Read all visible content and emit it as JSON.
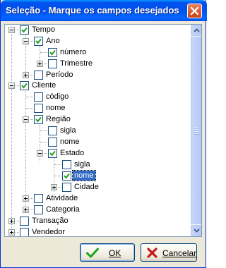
{
  "window": {
    "title": "Seleção - Marque os campos desejados"
  },
  "tree": {
    "items": [
      {
        "label": "Tempo",
        "checked": true
      },
      {
        "label": "Ano",
        "checked": true
      },
      {
        "label": "número",
        "checked": true
      },
      {
        "label": "Trimestre",
        "checked": false
      },
      {
        "label": "Período",
        "checked": false
      },
      {
        "label": "Cliente",
        "checked": true
      },
      {
        "label": "código",
        "checked": false
      },
      {
        "label": "nome",
        "checked": false
      },
      {
        "label": "Região",
        "checked": true
      },
      {
        "label": "sigla",
        "checked": false
      },
      {
        "label": "nome",
        "checked": false
      },
      {
        "label": "Estado",
        "checked": true
      },
      {
        "label": "sigla",
        "checked": false
      },
      {
        "label": "nome",
        "checked": true,
        "selected": true
      },
      {
        "label": "Cidade",
        "checked": false
      },
      {
        "label": "Atividade",
        "checked": false
      },
      {
        "label": "Categoria",
        "checked": false
      },
      {
        "label": "Transação",
        "checked": false
      },
      {
        "label": "Vendedor",
        "checked": false
      }
    ]
  },
  "buttons": {
    "ok_label": "OK",
    "cancel_label": "Cancelar"
  },
  "colors": {
    "titlebar": "#0053ee",
    "selection": "#316ac5",
    "check": "#21a121",
    "cancel_icon": "#c41a1a"
  }
}
